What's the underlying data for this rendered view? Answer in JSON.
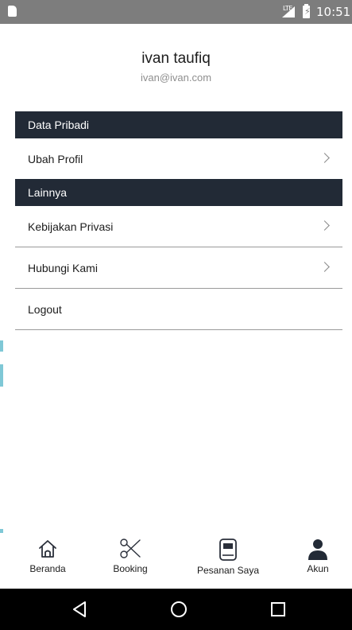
{
  "status_bar": {
    "time": "10:51",
    "network": "LTE",
    "icons": [
      "sim-card-icon",
      "signal-icon",
      "battery-charging-icon"
    ]
  },
  "profile": {
    "name": "ivan taufiq",
    "email": "ivan@ivan.com"
  },
  "sections": {
    "personal_data": {
      "title": "Data Pribadi",
      "items": [
        {
          "label": "Ubah Profil",
          "icon": "chevron-right-icon"
        }
      ]
    },
    "others": {
      "title": "Lainnya",
      "items": [
        {
          "label": "Kebijakan Privasi",
          "icon": "chevron-right-icon"
        },
        {
          "label": "Hubungi Kami",
          "icon": "chevron-right-icon"
        },
        {
          "label": "Logout"
        }
      ]
    }
  },
  "bottom_nav": {
    "items": [
      {
        "label": "Beranda",
        "icon": "home-icon"
      },
      {
        "label": "Booking",
        "icon": "scissors-icon"
      },
      {
        "label": "Pesanan Saya",
        "icon": "book-icon"
      },
      {
        "label": "Akun",
        "icon": "user-icon",
        "active": true
      }
    ]
  },
  "system_nav": {
    "icons": [
      "back-icon",
      "home-circle-icon",
      "recents-icon"
    ]
  },
  "colors": {
    "section_header_bg": "#222a36",
    "status_bar_bg": "#7d7d7d",
    "divider": "#9a9a9a",
    "text_primary": "#1c1c1c",
    "text_secondary": "#8e8e8e"
  }
}
